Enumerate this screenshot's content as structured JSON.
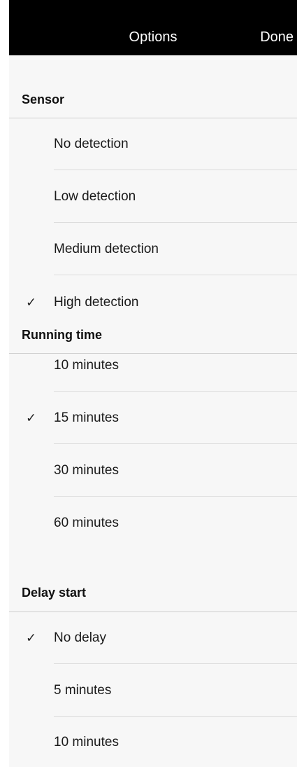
{
  "nav": {
    "title": "Options",
    "done_label": "Done"
  },
  "sections": [
    {
      "header": "Sensor",
      "options": [
        {
          "label": "No detection",
          "selected": false
        },
        {
          "label": "Low detection",
          "selected": false
        },
        {
          "label": "Medium detection",
          "selected": false
        },
        {
          "label": "High detection",
          "selected": true
        }
      ]
    },
    {
      "header": "Running time",
      "options": [
        {
          "label": "10 minutes",
          "selected": false
        },
        {
          "label": "15 minutes",
          "selected": true
        },
        {
          "label": "30 minutes",
          "selected": false
        },
        {
          "label": "60 minutes",
          "selected": false
        }
      ]
    },
    {
      "header": "Delay start",
      "options": [
        {
          "label": "No delay",
          "selected": true
        },
        {
          "label": "5 minutes",
          "selected": false
        },
        {
          "label": "10 minutes",
          "selected": false
        }
      ]
    }
  ],
  "icons": {
    "checkmark": "checkmark-icon"
  }
}
